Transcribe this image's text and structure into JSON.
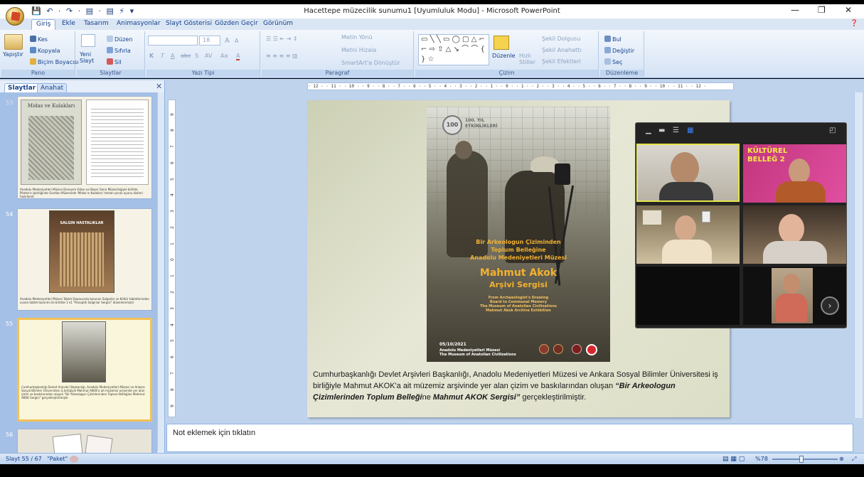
{
  "window": {
    "title": "Hacettepe müzecilik sunumu1 [Uyumluluk Modu] - Microsoft PowerPoint",
    "qat": "💾 ↶ · ↷ · ▤ · ▤ ⚡ ▾",
    "minimize": "—",
    "restore": "❐",
    "close": "✕"
  },
  "ribbon_tabs": [
    "Giriş",
    "Ekle",
    "Tasarım",
    "Animasyonlar",
    "Slayt Gösterisi",
    "Gözden Geçir",
    "Görünüm"
  ],
  "help": "❓",
  "ribbon": {
    "pano": {
      "label": "Pano",
      "paste": "Yapıştır",
      "cut": "Kes",
      "copy": "Kopyala",
      "format_painter": "Biçim Boyacısı"
    },
    "slaytlar": {
      "label": "Slaytlar",
      "new_slide": "Yeni Slayt",
      "layout": "Düzen",
      "reset": "Sıfırla",
      "delete": "Sil"
    },
    "yazi_tipi": {
      "label": "Yazı Tipi",
      "size": "18",
      "bold": "K",
      "italic": "T",
      "underline": "A",
      "strike": "abc",
      "shadow": "S",
      "spacing": "AV",
      "case": "Aa",
      "color": "A",
      "grow": "A",
      "shrink": "A"
    },
    "paragraf": {
      "label": "Paragraf",
      "text_direction": "Metin Yönü",
      "align_text": "Metni Hizala",
      "smartart": "SmartArt'a Dönüştür"
    },
    "cizim": {
      "label": "Çizim",
      "arrange": "Düzenle",
      "quick_styles": "Hızlı Stiller",
      "shape_fill": "Şekil Dolgusu",
      "shape_outline": "Şekil Anahattı",
      "shape_effects": "Şekil Efektleri"
    },
    "duzenleme": {
      "label": "Düzenleme",
      "find": "Bul",
      "replace": "Değiştir",
      "select": "Seç"
    }
  },
  "panel": {
    "tab_slides": "Slaytlar",
    "tab_outline": "Anahat",
    "close": "✕",
    "thumbs": [
      {
        "num": "53",
        "title": "Midas ve Kulakları",
        "caption": "Anadolu Medeniyetleri Müzesi Deneyim Odası ve Beşer Gene Müzecileğiyle birlikte Pilates'e işbirliğinde Gordion Müzesinde 'Midas'ın Kulakları' temalı çocuk oyunu dizileri hazırlandı"
      },
      {
        "num": "54",
        "title": "SALGIN HASTALIKLAR",
        "caption": "Anadolu Medeniyetleri Müzesi Tablet Deposunda bulunan Salgınlar ve Kültür tabletlerinden sunan tablet tasarımı ile birlikte 1 e1 \"Panoptik Salgınlar Sergisi\" düzenlenmiştir"
      },
      {
        "num": "55",
        "caption": "Cumhurbaşkanlığı Devlet Arşivleri Başkanlığı, Anadolu Medeniyetleri Müzesi ve Ankara Sosyal Bilimler Üniversitesi iş birliğiyle Mahmut AKOK'a ait müzemiz arşivinde yer alan çizim ve baskılarından oluşan \"Bir Arkeologun Çizimlerinden Toplum Belleğine Mahmut AKOK Sergisi\" gerçekleştirilmiştir."
      },
      {
        "num": "56"
      }
    ]
  },
  "ruler_h": "· 12 · · 11 · · 10 · · 9 · · 8 · · 7 · · 6 · · 5 · · 4 · · 3 · · 2 · · 1 · · 0 · · 1 · · 2 · · 3 · · 4 · · 5 · · 6 · · 7 · · 8 · · 9 · · 10 · · 11 · · 12 ·",
  "ruler_v": [
    "9",
    "8",
    "7",
    "6",
    "5",
    "4",
    "3",
    "2",
    "1",
    "0",
    "1",
    "2",
    "3",
    "4",
    "5",
    "6",
    "7",
    "8",
    "9"
  ],
  "slide": {
    "poster": {
      "badge_100": "100",
      "badge_text": "100. YIL ETKİNLİKLERİ",
      "line1": "Bir Arkeologun Çiziminden",
      "line2": "Toplum Belleğine",
      "line3": "Anadolu Medeniyetleri Müzesi",
      "name1": "Mahmut Akok",
      "name2": "Arşivi Sergisi",
      "eng1": "From Archaeologist's Drawing",
      "eng2": "Board to Communal Memory",
      "eng3": "The Museum of Anatolian Civilizations",
      "eng4": "Mahmut Akok Archive Exhibition",
      "date": "05/10/2021",
      "venue1": "Anadolu Medeniyetleri Müzesi",
      "venue2": "The Museum of Anatolian Civilizations"
    },
    "caption_a": "Cumhurbaşkanlığı Devlet Arşivleri Başkanlığı, Anadolu Medeniyetleri Müzesi ve Ankara Sosyal Bilimler Üniversitesi iş birliğiyle Mahmut AKOK'a ait müzemiz arşivinde yer alan çizim ve baskılarından oluşan ",
    "caption_b": "“Bir Arkeologun Çizimlerinden Toplum Belleği",
    "caption_c": "ne ",
    "caption_d": "Mahmut AKOK Sergisi”",
    "caption_e": " gerçekleştirilmiştir."
  },
  "notes_placeholder": "Not eklemek için tıklatın",
  "video": {
    "tile_banner": "KÜLTÜREL BELLEĞ 2",
    "next": "›"
  },
  "status": {
    "slide": "Slayt 55 / 67",
    "theme": "\"Paket\"",
    "zoom": "%78"
  }
}
